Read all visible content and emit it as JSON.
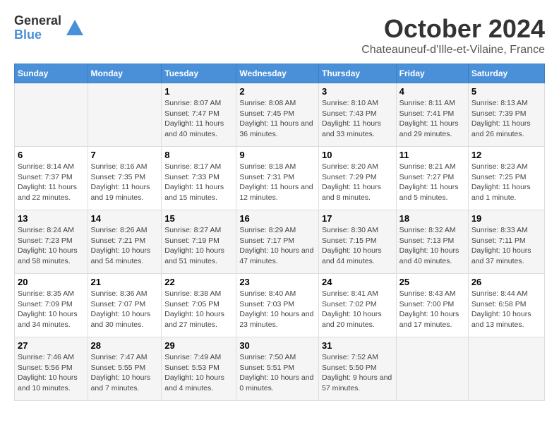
{
  "header": {
    "logo": {
      "general": "General",
      "blue": "Blue"
    },
    "month": "October 2024",
    "location": "Chateauneuf-d'Ille-et-Vilaine, France"
  },
  "days_of_week": [
    "Sunday",
    "Monday",
    "Tuesday",
    "Wednesday",
    "Thursday",
    "Friday",
    "Saturday"
  ],
  "weeks": [
    [
      {
        "day": "",
        "detail": ""
      },
      {
        "day": "",
        "detail": ""
      },
      {
        "day": "1",
        "detail": "Sunrise: 8:07 AM\nSunset: 7:47 PM\nDaylight: 11 hours and 40 minutes."
      },
      {
        "day": "2",
        "detail": "Sunrise: 8:08 AM\nSunset: 7:45 PM\nDaylight: 11 hours and 36 minutes."
      },
      {
        "day": "3",
        "detail": "Sunrise: 8:10 AM\nSunset: 7:43 PM\nDaylight: 11 hours and 33 minutes."
      },
      {
        "day": "4",
        "detail": "Sunrise: 8:11 AM\nSunset: 7:41 PM\nDaylight: 11 hours and 29 minutes."
      },
      {
        "day": "5",
        "detail": "Sunrise: 8:13 AM\nSunset: 7:39 PM\nDaylight: 11 hours and 26 minutes."
      }
    ],
    [
      {
        "day": "6",
        "detail": "Sunrise: 8:14 AM\nSunset: 7:37 PM\nDaylight: 11 hours and 22 minutes."
      },
      {
        "day": "7",
        "detail": "Sunrise: 8:16 AM\nSunset: 7:35 PM\nDaylight: 11 hours and 19 minutes."
      },
      {
        "day": "8",
        "detail": "Sunrise: 8:17 AM\nSunset: 7:33 PM\nDaylight: 11 hours and 15 minutes."
      },
      {
        "day": "9",
        "detail": "Sunrise: 8:18 AM\nSunset: 7:31 PM\nDaylight: 11 hours and 12 minutes."
      },
      {
        "day": "10",
        "detail": "Sunrise: 8:20 AM\nSunset: 7:29 PM\nDaylight: 11 hours and 8 minutes."
      },
      {
        "day": "11",
        "detail": "Sunrise: 8:21 AM\nSunset: 7:27 PM\nDaylight: 11 hours and 5 minutes."
      },
      {
        "day": "12",
        "detail": "Sunrise: 8:23 AM\nSunset: 7:25 PM\nDaylight: 11 hours and 1 minute."
      }
    ],
    [
      {
        "day": "13",
        "detail": "Sunrise: 8:24 AM\nSunset: 7:23 PM\nDaylight: 10 hours and 58 minutes."
      },
      {
        "day": "14",
        "detail": "Sunrise: 8:26 AM\nSunset: 7:21 PM\nDaylight: 10 hours and 54 minutes."
      },
      {
        "day": "15",
        "detail": "Sunrise: 8:27 AM\nSunset: 7:19 PM\nDaylight: 10 hours and 51 minutes."
      },
      {
        "day": "16",
        "detail": "Sunrise: 8:29 AM\nSunset: 7:17 PM\nDaylight: 10 hours and 47 minutes."
      },
      {
        "day": "17",
        "detail": "Sunrise: 8:30 AM\nSunset: 7:15 PM\nDaylight: 10 hours and 44 minutes."
      },
      {
        "day": "18",
        "detail": "Sunrise: 8:32 AM\nSunset: 7:13 PM\nDaylight: 10 hours and 40 minutes."
      },
      {
        "day": "19",
        "detail": "Sunrise: 8:33 AM\nSunset: 7:11 PM\nDaylight: 10 hours and 37 minutes."
      }
    ],
    [
      {
        "day": "20",
        "detail": "Sunrise: 8:35 AM\nSunset: 7:09 PM\nDaylight: 10 hours and 34 minutes."
      },
      {
        "day": "21",
        "detail": "Sunrise: 8:36 AM\nSunset: 7:07 PM\nDaylight: 10 hours and 30 minutes."
      },
      {
        "day": "22",
        "detail": "Sunrise: 8:38 AM\nSunset: 7:05 PM\nDaylight: 10 hours and 27 minutes."
      },
      {
        "day": "23",
        "detail": "Sunrise: 8:40 AM\nSunset: 7:03 PM\nDaylight: 10 hours and 23 minutes."
      },
      {
        "day": "24",
        "detail": "Sunrise: 8:41 AM\nSunset: 7:02 PM\nDaylight: 10 hours and 20 minutes."
      },
      {
        "day": "25",
        "detail": "Sunrise: 8:43 AM\nSunset: 7:00 PM\nDaylight: 10 hours and 17 minutes."
      },
      {
        "day": "26",
        "detail": "Sunrise: 8:44 AM\nSunset: 6:58 PM\nDaylight: 10 hours and 13 minutes."
      }
    ],
    [
      {
        "day": "27",
        "detail": "Sunrise: 7:46 AM\nSunset: 5:56 PM\nDaylight: 10 hours and 10 minutes."
      },
      {
        "day": "28",
        "detail": "Sunrise: 7:47 AM\nSunset: 5:55 PM\nDaylight: 10 hours and 7 minutes."
      },
      {
        "day": "29",
        "detail": "Sunrise: 7:49 AM\nSunset: 5:53 PM\nDaylight: 10 hours and 4 minutes."
      },
      {
        "day": "30",
        "detail": "Sunrise: 7:50 AM\nSunset: 5:51 PM\nDaylight: 10 hours and 0 minutes."
      },
      {
        "day": "31",
        "detail": "Sunrise: 7:52 AM\nSunset: 5:50 PM\nDaylight: 9 hours and 57 minutes."
      },
      {
        "day": "",
        "detail": ""
      },
      {
        "day": "",
        "detail": ""
      }
    ]
  ]
}
